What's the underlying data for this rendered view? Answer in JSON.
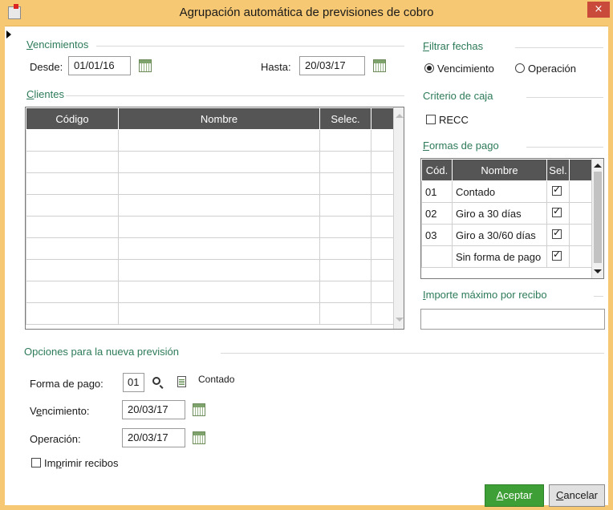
{
  "window": {
    "title": "Agrupación automática de previsiones de cobro",
    "close_symbol": "×"
  },
  "vencimientos": {
    "section_label_u": "V",
    "section_label_rest": "encimientos",
    "desde_label": "Desde:",
    "desde_value": "01/01/16",
    "hasta_label": "Hasta:",
    "hasta_value": "20/03/17"
  },
  "filtrar_fechas": {
    "section_label_u": "F",
    "section_label_rest": "iltrar fechas",
    "options": [
      {
        "label": "Vencimiento",
        "selected": true
      },
      {
        "label": "Operación",
        "selected": false
      }
    ]
  },
  "clientes": {
    "section_label_u": "C",
    "section_label_rest": "lientes",
    "columns": [
      "Código",
      "Nombre",
      "Selec."
    ],
    "rows": [
      [
        "",
        "",
        ""
      ],
      [
        "",
        "",
        ""
      ],
      [
        "",
        "",
        ""
      ],
      [
        "",
        "",
        ""
      ],
      [
        "",
        "",
        ""
      ],
      [
        "",
        "",
        ""
      ],
      [
        "",
        "",
        ""
      ],
      [
        "",
        "",
        ""
      ],
      [
        "",
        "",
        ""
      ]
    ]
  },
  "criterio_caja": {
    "section_label": "Criterio de caja",
    "recc_label": "RECC",
    "recc_checked": false
  },
  "formas_pago": {
    "section_label_u": "F",
    "section_label_rest": "ormas de pago",
    "columns": [
      "Cód.",
      "Nombre",
      "Sel."
    ],
    "rows": [
      {
        "cod": "01",
        "nombre": "Contado",
        "sel": true
      },
      {
        "cod": "02",
        "nombre": "Giro a 30 días",
        "sel": true
      },
      {
        "cod": "03",
        "nombre": "Giro a 30/60 días",
        "sel": true
      },
      {
        "cod": "",
        "nombre": "Sin forma de pago",
        "sel": true
      }
    ]
  },
  "importe_maximo": {
    "section_label_u": "I",
    "section_label_rest": "mporte máximo por recibo",
    "value": ""
  },
  "opciones": {
    "section_label": "Opciones para la nueva previsión",
    "forma_pago_label": "Forma de pago:",
    "forma_pago_value": "01",
    "forma_pago_desc": "Contado",
    "vencimiento_label_pre": "V",
    "vencimiento_label_u": "e",
    "vencimiento_label_rest": "ncimiento:",
    "vencimiento_value": "20/03/17",
    "operacion_label": "Operación:",
    "operacion_value": "20/03/17",
    "imprimir_pre": "Im",
    "imprimir_u": "p",
    "imprimir_rest": "rimir recibos",
    "imprimir_checked": false
  },
  "buttons": {
    "aceptar_u": "A",
    "aceptar_rest": "ceptar",
    "cancelar_u": "C",
    "cancelar_rest": "ancelar"
  },
  "colors": {
    "title_bar": "#f7c873",
    "section_text": "#2c7a58",
    "grid_header": "#555555",
    "accept_button": "#3e9f37"
  }
}
